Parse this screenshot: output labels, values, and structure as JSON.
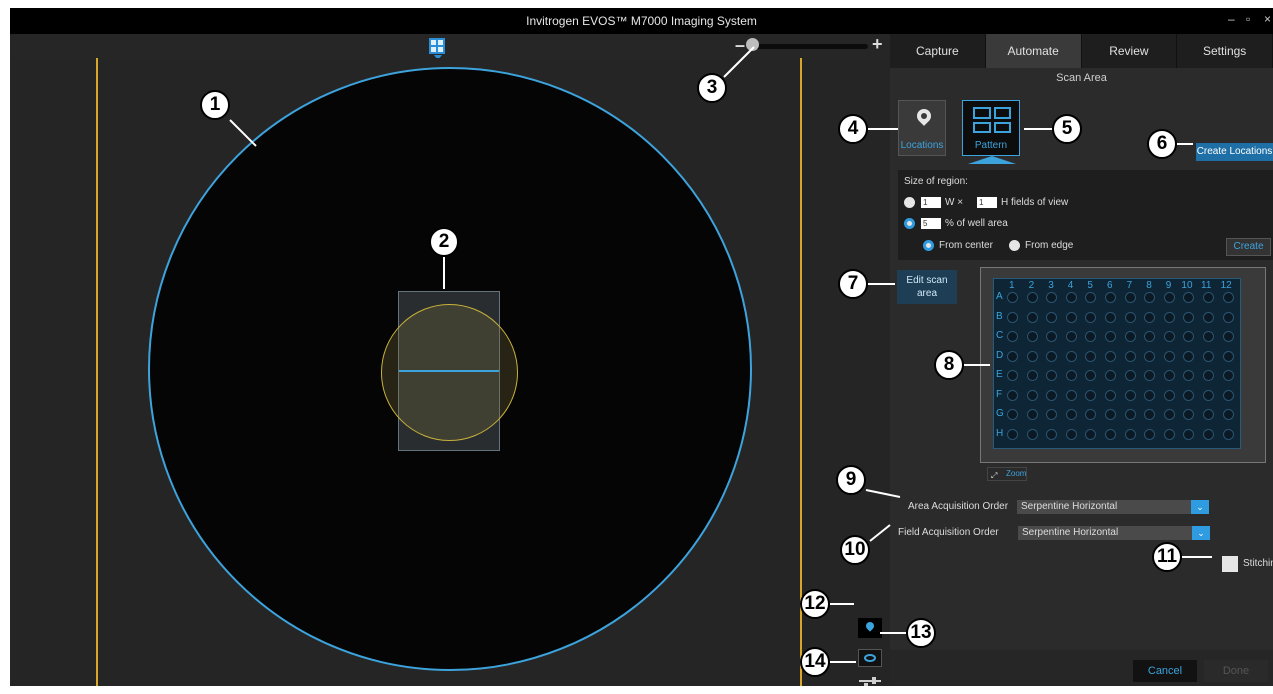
{
  "window": {
    "title": "Invitrogen EVOS™ M7000 Imaging System",
    "minimize": "–",
    "restore": "▫",
    "close": "×"
  },
  "zoom_control": {
    "minus": "–",
    "plus": "+"
  },
  "tabs": [
    {
      "label": "Capture",
      "active": false
    },
    {
      "label": "Automate",
      "active": true
    },
    {
      "label": "Review",
      "active": false
    },
    {
      "label": "Settings",
      "active": false
    }
  ],
  "scan_area": {
    "header": "Scan Area",
    "locations_label": "Locations",
    "pattern_label": "Pattern",
    "create_locations_label": "Create Locations",
    "size_of_region": "Size of region:",
    "fov_w_value": "1",
    "fov_w_label": "W  ×",
    "fov_h_value": "1",
    "fov_h_label": "H  fields of view",
    "percent_value": "5",
    "percent_label": "% of well area",
    "from_center": "From center",
    "from_edge": "From edge",
    "create_label": "Create",
    "edit_scan_area_label": "Edit scan area",
    "zoom_label": "Zoom",
    "area_acq_label": "Area Acquisition Order",
    "area_acq_value": "Serpentine Horizontal",
    "field_acq_label": "Field Acquisition Order",
    "field_acq_value": "Serpentine Horizontal",
    "stitching_label": "Stitching",
    "cancel_label": "Cancel",
    "done_label": "Done"
  },
  "plate": {
    "columns": [
      "1",
      "2",
      "3",
      "4",
      "5",
      "6",
      "7",
      "8",
      "9",
      "10",
      "11",
      "12"
    ],
    "rows": [
      "A",
      "B",
      "C",
      "D",
      "E",
      "F",
      "G",
      "H"
    ]
  },
  "callouts": [
    "1",
    "2",
    "3",
    "4",
    "5",
    "6",
    "7",
    "8",
    "9",
    "10",
    "11",
    "12",
    "13",
    "14"
  ],
  "colors": {
    "accent": "#3da3dd",
    "guide_line": "#d7a62a",
    "scan_circle": "#c8b23a"
  },
  "icons": {
    "view_toggle": "grid-icon",
    "locations": "map-pin-icon",
    "pattern": "pattern-grid-icon",
    "locations_toggle": "map-pin-icon",
    "visibility": "eye-icon",
    "adjustments": "sliders-icon",
    "zoom": "expand-icon"
  }
}
